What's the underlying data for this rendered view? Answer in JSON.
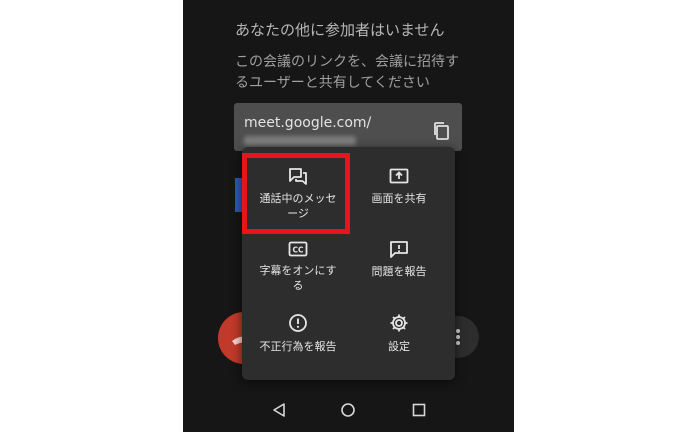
{
  "meeting_info": {
    "title": "あなたの他に参加者はいません",
    "instructions": "この会議のリンクを、会議に招待するユーザーと共有してください",
    "link_text": "meet.google.com/"
  },
  "menu": {
    "items": [
      {
        "label": "通話中のメッセージ",
        "icon": "chat-bubbles-icon"
      },
      {
        "label": "画面を共有",
        "icon": "present-screen-icon"
      },
      {
        "label": "字幕をオンにする",
        "icon": "closed-captions-icon"
      },
      {
        "label": "問題を報告",
        "icon": "feedback-icon"
      },
      {
        "label": "不正行為を報告",
        "icon": "warning-icon"
      },
      {
        "label": "設定",
        "icon": "gear-icon"
      }
    ]
  },
  "colors": {
    "highlight": "#e8141b",
    "menu_background": "#2d2d2d",
    "screen_background": "#161616"
  }
}
